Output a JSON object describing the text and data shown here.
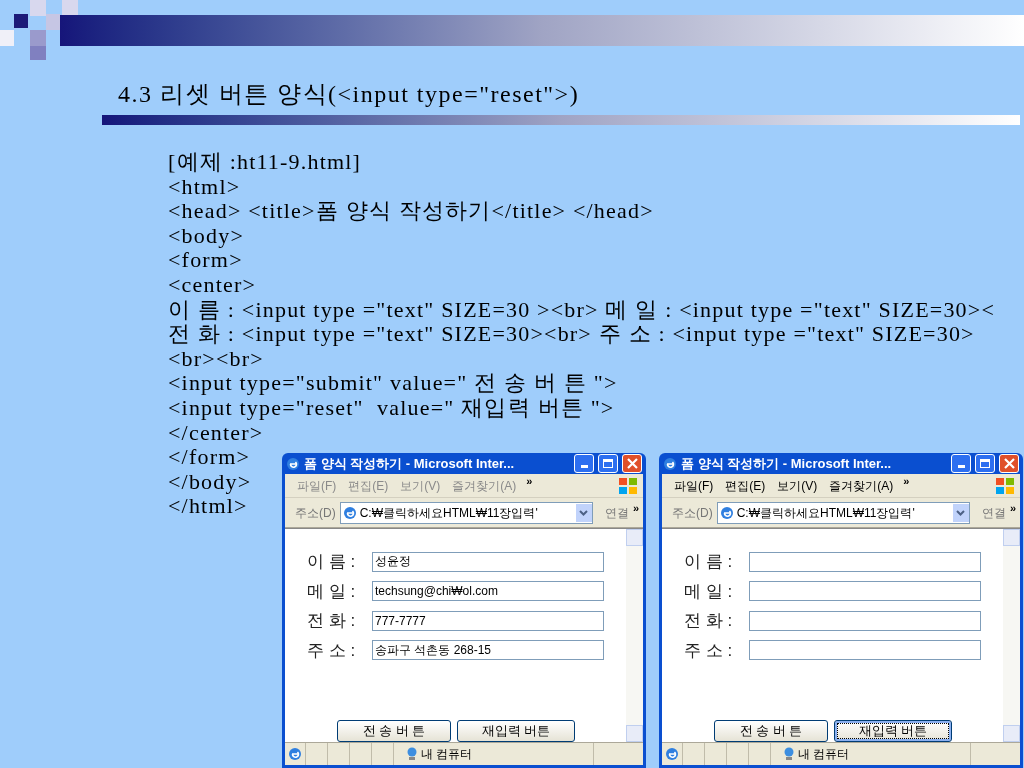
{
  "title": "4.3 리셋 버튼 양식(<input type=\"reset\">)",
  "code_lines": [
    "[예제 :ht11-9.html]",
    "<html>",
    "<head> <title>폼 양식 작성하기</title> </head>",
    "<body>",
    "<form>",
    "<center>",
    "이 름 : <input type =\"text\" SIZE=30 ><br> 메 일 : <input type =\"text\" SIZE=30><",
    "전 화 : <input type =\"text\" SIZE=30><br> 주 소 : <input type =\"text\" SIZE=30>",
    "<br><br>",
    "<input type=\"submit\" value=\" 전 송 버 튼 \">",
    "<input type=\"reset\"  value=\" 재입력 버튼 \">",
    "</center>",
    "</form>",
    "</body>",
    "</html>"
  ],
  "windows": [
    {
      "title": "폼 양식 작성하기 - Microsoft Inter...",
      "menu": [
        "파일(F)",
        "편집(E)",
        "보기(V)",
        "즐겨찾기(A)"
      ],
      "menu_more": "»",
      "address_label": "주소(D)",
      "address": "C:₩클릭하세요HTML₩11장입력'",
      "links": "연결",
      "links_more": "»",
      "fields": [
        {
          "label": "이 름 :",
          "value": "성윤정"
        },
        {
          "label": "메 일 :",
          "value": "techsung@chi₩ol.com"
        },
        {
          "label": "전 화 :",
          "value": "777-7777"
        },
        {
          "label": "주 소 :",
          "value": "송파구 석촌동 268-15"
        }
      ],
      "buttons": [
        {
          "label": "전 송 버 튼",
          "focused": false
        },
        {
          "label": "재입력 버튼",
          "focused": false
        }
      ],
      "status": "내 컴퓨터"
    },
    {
      "title": "폼 양식 작성하기 - Microsoft Inter...",
      "menu": [
        "파일(F)",
        "편집(E)",
        "보기(V)",
        "즐겨찾기(A)"
      ],
      "menu_more": "»",
      "address_label": "주소(D)",
      "address": "C:₩클릭하세요HTML₩11장입력'",
      "links": "연결",
      "links_more": "»",
      "fields": [
        {
          "label": "이 름 :"
        },
        {
          "label": "메 일 :"
        },
        {
          "label": "전 화 :"
        },
        {
          "label": "주 소 :"
        }
      ],
      "buttons": [
        {
          "label": "전 송 버 튼",
          "focused": false
        },
        {
          "label": "재입력 버튼",
          "focused": true
        }
      ],
      "status": "내 컴퓨터"
    }
  ]
}
